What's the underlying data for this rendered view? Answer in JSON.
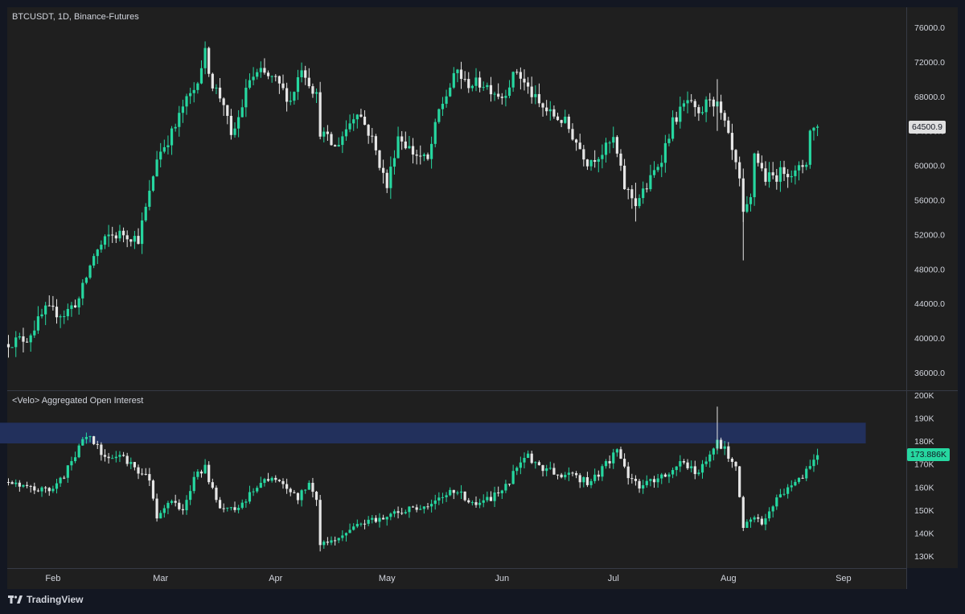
{
  "header": {
    "symbol_title": "BTCUSDT, 1D, Binance-Futures",
    "indicator_title": "<Velo> Aggregated Open Interest"
  },
  "branding": {
    "name": "TradingView",
    "logo": "tradingview-logo-icon"
  },
  "colors": {
    "background": "#131722",
    "pane": "#1f1f1f",
    "up": "#26d7a0",
    "down": "#e6e6e6",
    "highlight_zone": "#22305c",
    "current_oi_tag": "#26d7a0"
  },
  "chart_data": [
    {
      "type": "candlestick",
      "title": "BTCUSDT, 1D, Binance-Futures",
      "x_range": [
        "2024-01-20",
        "2024-08-25"
      ],
      "y_range": [
        34000,
        78000
      ],
      "y_ticks": [
        "76000.0",
        "72000.0",
        "68000.0",
        "64000.0",
        "60000.0",
        "56000.0",
        "52000.0",
        "48000.0",
        "44000.0",
        "40000.0",
        "36000.0"
      ],
      "last_value_label": "64500.9",
      "last_value": 64500.9,
      "series_close": [
        [
          "2024-01-20",
          39500
        ],
        [
          "2024-01-25",
          40000
        ],
        [
          "2024-01-30",
          43200
        ],
        [
          "2024-02-04",
          42800
        ],
        [
          "2024-02-08",
          44500
        ],
        [
          "2024-02-12",
          49600
        ],
        [
          "2024-02-16",
          51800
        ],
        [
          "2024-02-20",
          52100
        ],
        [
          "2024-02-24",
          51500
        ],
        [
          "2024-02-27",
          56700
        ],
        [
          "2024-02-29",
          61000
        ],
        [
          "2024-03-03",
          63000
        ],
        [
          "2024-03-05",
          64500
        ],
        [
          "2024-03-07",
          66800
        ],
        [
          "2024-03-10",
          68800
        ],
        [
          "2024-03-13",
          73000
        ],
        [
          "2024-03-15",
          69400
        ],
        [
          "2024-03-18",
          67300
        ],
        [
          "2024-03-20",
          63000
        ],
        [
          "2024-03-22",
          65500
        ],
        [
          "2024-03-25",
          70000
        ],
        [
          "2024-03-28",
          70700
        ],
        [
          "2024-04-01",
          69800
        ],
        [
          "2024-04-05",
          67500
        ],
        [
          "2024-04-08",
          71500
        ],
        [
          "2024-04-12",
          68000
        ],
        [
          "2024-04-13",
          64000
        ],
        [
          "2024-04-17",
          62000
        ],
        [
          "2024-04-19",
          63500
        ],
        [
          "2024-04-23",
          66500
        ],
        [
          "2024-04-27",
          63000
        ],
        [
          "2024-05-01",
          57500
        ],
        [
          "2024-05-04",
          63500
        ],
        [
          "2024-05-08",
          61500
        ],
        [
          "2024-05-12",
          60500
        ],
        [
          "2024-05-15",
          66300
        ],
        [
          "2024-05-20",
          71000
        ],
        [
          "2024-05-22",
          69500
        ],
        [
          "2024-05-27",
          69500
        ],
        [
          "2024-06-01",
          68000
        ],
        [
          "2024-06-05",
          71000
        ],
        [
          "2024-06-07",
          69500
        ],
        [
          "2024-06-11",
          67000
        ],
        [
          "2024-06-14",
          66000
        ],
        [
          "2024-06-18",
          65000
        ],
        [
          "2024-06-24",
          60500
        ],
        [
          "2024-06-28",
          61500
        ],
        [
          "2024-07-01",
          63000
        ],
        [
          "2024-07-04",
          57500
        ],
        [
          "2024-07-07",
          55700
        ],
        [
          "2024-07-10",
          57500
        ],
        [
          "2024-07-14",
          61000
        ],
        [
          "2024-07-17",
          65000
        ],
        [
          "2024-07-21",
          67500
        ],
        [
          "2024-07-24",
          65500
        ],
        [
          "2024-07-27",
          68000
        ],
        [
          "2024-07-29",
          66800
        ],
        [
          "2024-07-31",
          64700
        ],
        [
          "2024-08-02",
          61500
        ],
        [
          "2024-08-04",
          58100
        ],
        [
          "2024-08-05",
          54000
        ],
        [
          "2024-08-07",
          56000
        ],
        [
          "2024-08-08",
          61500
        ],
        [
          "2024-08-11",
          58500
        ],
        [
          "2024-08-14",
          58800
        ],
        [
          "2024-08-16",
          59500
        ],
        [
          "2024-08-19",
          59000
        ],
        [
          "2024-08-22",
          60500
        ],
        [
          "2024-08-23",
          64000
        ],
        [
          "2024-08-25",
          64500
        ]
      ]
    },
    {
      "type": "candlestick",
      "title": "<Velo> Aggregated Open Interest",
      "x_range": [
        "2024-01-20",
        "2024-08-25"
      ],
      "y_range": [
        125000,
        200000
      ],
      "y_ticks": [
        "200K",
        "190K",
        "180K",
        "170K",
        "160K",
        "150K",
        "140K",
        "130K"
      ],
      "last_value_label": "173.886K",
      "last_value": 173886,
      "highlight_zone": {
        "y_range": [
          179000,
          188000
        ],
        "x_range": [
          "2024-01-16",
          "2024-09-07"
        ]
      },
      "series_close": [
        [
          "2024-01-20",
          163000
        ],
        [
          "2024-01-25",
          161000
        ],
        [
          "2024-01-30",
          158000
        ],
        [
          "2024-02-03",
          163000
        ],
        [
          "2024-02-06",
          171000
        ],
        [
          "2024-02-10",
          183000
        ],
        [
          "2024-02-14",
          175000
        ],
        [
          "2024-02-19",
          173000
        ],
        [
          "2024-02-23",
          169000
        ],
        [
          "2024-02-27",
          163000
        ],
        [
          "2024-02-29",
          146000
        ],
        [
          "2024-03-04",
          155000
        ],
        [
          "2024-03-07",
          150000
        ],
        [
          "2024-03-10",
          165000
        ],
        [
          "2024-03-13",
          168000
        ],
        [
          "2024-03-16",
          153000
        ],
        [
          "2024-03-20",
          150000
        ],
        [
          "2024-03-24",
          155000
        ],
        [
          "2024-03-27",
          160000
        ],
        [
          "2024-03-31",
          165000
        ],
        [
          "2024-04-03",
          160000
        ],
        [
          "2024-04-07",
          155000
        ],
        [
          "2024-04-10",
          162000
        ],
        [
          "2024-04-12",
          155000
        ],
        [
          "2024-04-13",
          135000
        ],
        [
          "2024-04-17",
          138000
        ],
        [
          "2024-04-21",
          141000
        ],
        [
          "2024-04-25",
          145000
        ],
        [
          "2024-04-29",
          146000
        ],
        [
          "2024-05-02",
          149000
        ],
        [
          "2024-05-07",
          150000
        ],
        [
          "2024-05-12",
          152000
        ],
        [
          "2024-05-16",
          156000
        ],
        [
          "2024-05-20",
          158000
        ],
        [
          "2024-05-24",
          152000
        ],
        [
          "2024-05-28",
          154000
        ],
        [
          "2024-06-01",
          158000
        ],
        [
          "2024-06-05",
          168000
        ],
        [
          "2024-06-08",
          173000
        ],
        [
          "2024-06-12",
          168000
        ],
        [
          "2024-06-17",
          166000
        ],
        [
          "2024-06-21",
          164000
        ],
        [
          "2024-06-25",
          162000
        ],
        [
          "2024-06-29",
          170000
        ],
        [
          "2024-07-02",
          176000
        ],
        [
          "2024-07-05",
          165000
        ],
        [
          "2024-07-08",
          160000
        ],
        [
          "2024-07-12",
          163000
        ],
        [
          "2024-07-16",
          166000
        ],
        [
          "2024-07-20",
          171000
        ],
        [
          "2024-07-24",
          166000
        ],
        [
          "2024-07-27",
          175000
        ],
        [
          "2024-07-29",
          180000
        ],
        [
          "2024-07-31",
          176000
        ],
        [
          "2024-08-03",
          170000
        ],
        [
          "2024-08-04",
          156000
        ],
        [
          "2024-08-05",
          143000
        ],
        [
          "2024-08-08",
          146000
        ],
        [
          "2024-08-11",
          145000
        ],
        [
          "2024-08-14",
          156000
        ],
        [
          "2024-08-18",
          160000
        ],
        [
          "2024-08-21",
          165000
        ],
        [
          "2024-08-23",
          170000
        ],
        [
          "2024-08-25",
          173886
        ]
      ]
    }
  ],
  "x_axis": {
    "labels": [
      "Feb",
      "Mar",
      "Apr",
      "May",
      "Jun",
      "Jul",
      "Aug",
      "Sep"
    ],
    "dates": [
      "2024-02-01",
      "2024-03-01",
      "2024-04-01",
      "2024-05-01",
      "2024-06-01",
      "2024-07-01",
      "2024-08-01",
      "2024-09-01"
    ]
  }
}
